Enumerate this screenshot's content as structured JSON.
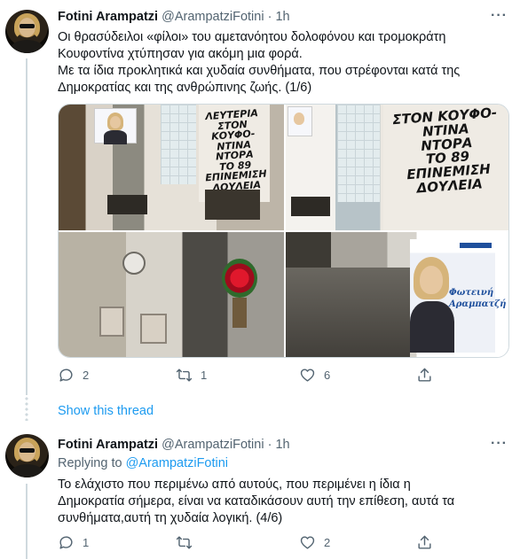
{
  "tweets": [
    {
      "author": "Fotini Arampatzi",
      "handle": "@ArampatziFotini",
      "time": "1h",
      "text_lines": [
        "Οι θρασύδειλοι «φίλοι» του αμετανόητου δολοφόνου και τρομοκράτη",
        "Κουφοντίνα χτύπησαν για ακόμη μια φορά.",
        "Με τα ίδια προκλητικά και χυδαία συνθήματα, που στρέφονται κατά της",
        "Δημοκρατίας και της ανθρώπινης ζωής. (1/6)"
      ],
      "graffiti": {
        "photo1": [
          "ΛΕΥΤΕΡΙΑ",
          "ΣΤΟΝ ΚΟΥΦΟ-",
          "ΝΤΙΝΑ",
          "ΝΤΟΡΑ",
          "ΤΟ 89",
          "ΕΠΙΝΕΜΙΣΗ",
          "ΔΟΥΛΕΙΑ"
        ],
        "photo2": [
          "ΣΤΟΝ ΚΟΥΦΟ-",
          "ΝΤΙΝΑ",
          "ΝΤΟΡΑ",
          "ΤΟ 89",
          "ΕΠΙΝΕΜΙΣΗ",
          "ΔΟΥΛΕΙΑ"
        ]
      },
      "poster_name": [
        "Φωτεινή",
        "Αραμπατζή"
      ],
      "actions": {
        "replies": "2",
        "retweets": "1",
        "likes": "6"
      }
    },
    {
      "author": "Fotini Arampatzi",
      "handle": "@ArampatziFotini",
      "time": "1h",
      "replying_prefix": "Replying to",
      "replying_to": "@ArampatziFotini",
      "text_lines": [
        "Το ελάχιστο που περιμένω από αυτούς, που περιμένει η  ίδια η",
        "Δημοκρατία  σήμερα, είναι να καταδικάσουν  αυτή την επίθεση, αυτά τα",
        "συνθήματα,αυτή τη χυδαία λογική. (4/6)"
      ],
      "actions": {
        "replies": "1",
        "retweets": "",
        "likes": "2"
      }
    }
  ],
  "show_thread": "Show this thread",
  "header_separator": "·",
  "more_icon": "···",
  "colors": {
    "link": "#1d9bf0",
    "secondary": "#536471",
    "text": "#0f1419",
    "border": "#cfd9de"
  }
}
